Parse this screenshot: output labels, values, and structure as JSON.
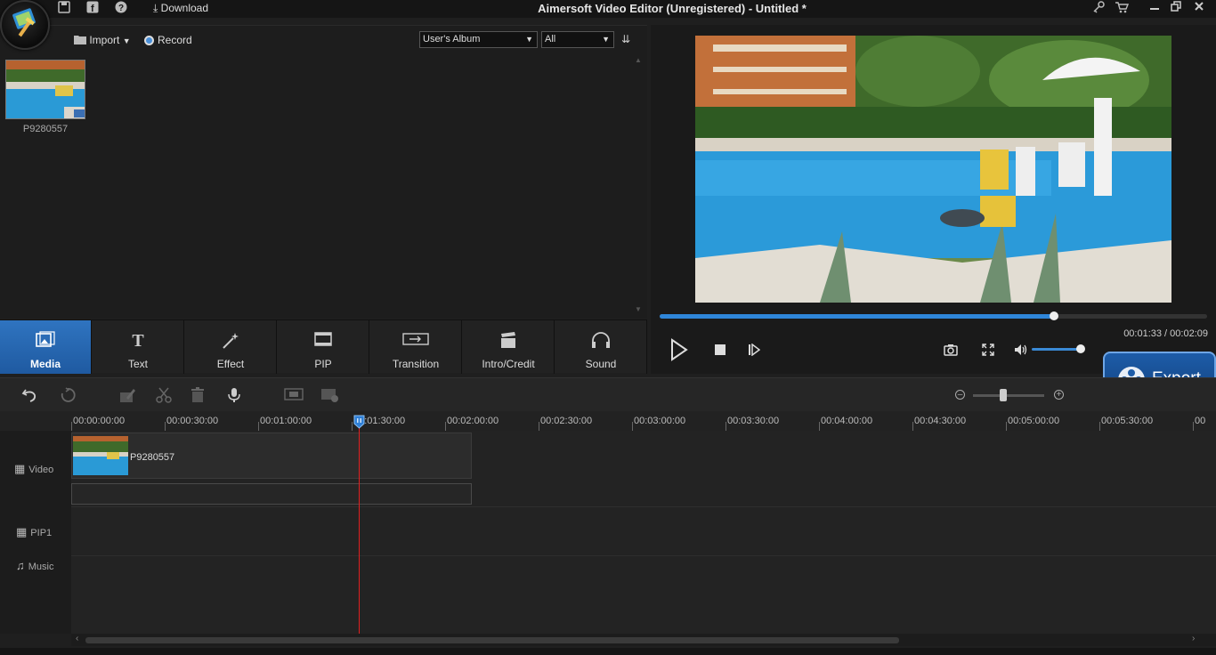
{
  "titlebar": {
    "title": "Aimersoft Video Editor (Unregistered) - Untitled *",
    "download_label": "Download",
    "icons": [
      "save-icon",
      "facebook-icon",
      "help-icon",
      "download-icon",
      "key-icon",
      "cart-icon",
      "minimize-icon",
      "restore-icon",
      "close-icon"
    ]
  },
  "media": {
    "import_label": "Import",
    "record_label": "Record",
    "album_value": "User's Album",
    "filter_value": "All",
    "items": [
      {
        "name": "P9280557"
      }
    ]
  },
  "tabs": [
    {
      "label": "Media",
      "icon": "media-icon",
      "active": true
    },
    {
      "label": "Text",
      "icon": "text-icon",
      "active": false
    },
    {
      "label": "Effect",
      "icon": "effect-wand-icon",
      "active": false
    },
    {
      "label": "PIP",
      "icon": "pip-icon",
      "active": false
    },
    {
      "label": "Transition",
      "icon": "transition-icon",
      "active": false
    },
    {
      "label": "Intro/Credit",
      "icon": "clapperboard-icon",
      "active": false
    },
    {
      "label": "Sound",
      "icon": "headphones-icon",
      "active": false
    }
  ],
  "preview": {
    "current_time": "00:01:33",
    "total_time": "00:02:09",
    "time_readout": "00:01:33 / 00:02:09",
    "progress": 0.72,
    "volume": 0.95
  },
  "export_label": "Export",
  "timeline": {
    "zoom_level": 0.43,
    "ruler": [
      "00:00:00:00",
      "00:00:30:00",
      "00:01:00:00",
      "00:01:30:00",
      "00:02:00:00",
      "00:02:30:00",
      "00:03:00:00",
      "00:03:30:00",
      "00:04:00:00",
      "00:04:30:00",
      "00:05:00:00",
      "00:05:30:00",
      "00"
    ],
    "tracks": {
      "video_label": "Video",
      "pip_label": "PIP1",
      "music_label": "Music"
    },
    "clip": {
      "name": "P9280557"
    }
  },
  "colors": {
    "accent": "#2f74c0",
    "playhead": "#e02020",
    "progress": "#2f86d9"
  }
}
